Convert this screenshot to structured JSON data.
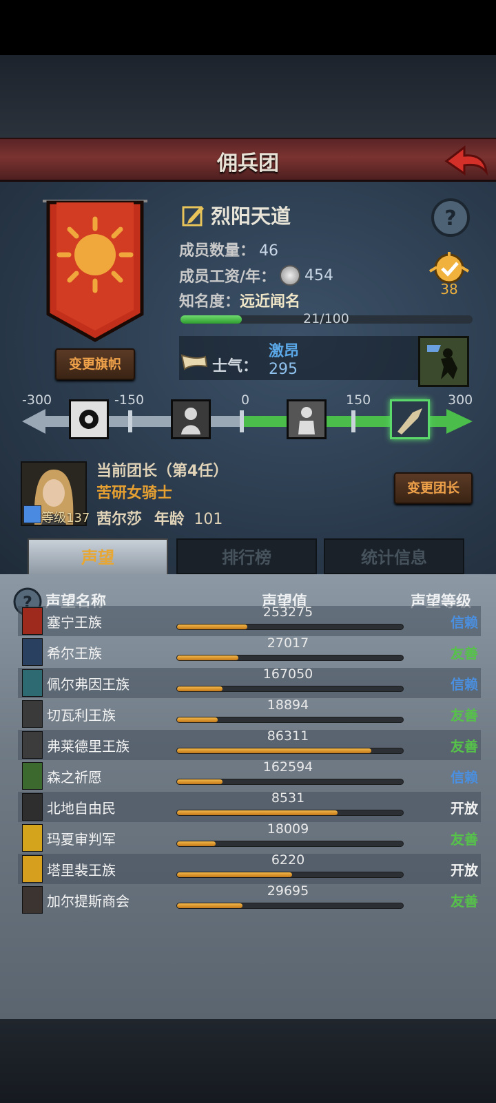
{
  "title": "佣兵团",
  "guild": {
    "name": "烈阳天道",
    "members_label": "成员数量：",
    "members_value": "46",
    "wage_label": "成员工资/年：",
    "wage_value": "454",
    "fame_label": "知名度：",
    "fame_value": "远近闻名",
    "fame_progress": "21/100",
    "fame_fraction": 0.21,
    "badge_value": "38",
    "change_flag_label": "变更旗帜"
  },
  "morale": {
    "label": "士气：",
    "state": "激昂",
    "value": "295",
    "scale_labels": [
      "-300",
      "-150",
      "0",
      "150",
      "300"
    ]
  },
  "leader": {
    "line1": "当前团长（第4任）",
    "title": "苦研女骑士",
    "name": "茜尔莎",
    "age_label": "年龄",
    "age_value": "101",
    "level_text": "等级137",
    "change_leader_label": "变更团长"
  },
  "tabs": [
    "声望",
    "排行榜",
    "统计信息"
  ],
  "reputation": {
    "headers": [
      "声望名称",
      "声望值",
      "声望等级"
    ],
    "rows": [
      {
        "name": "塞宁王族",
        "value": "253275",
        "level": "信赖",
        "fill": 0.31,
        "icon_color": "#9e2a1e",
        "level_color": "#4a8fe0"
      },
      {
        "name": "希尔王族",
        "value": "27017",
        "level": "友善",
        "fill": 0.27,
        "icon_color": "#2a4060",
        "level_color": "#56c24a"
      },
      {
        "name": "佩尔弗因王族",
        "value": "167050",
        "level": "信赖",
        "fill": 0.2,
        "icon_color": "#2e6a72",
        "level_color": "#4a8fe0"
      },
      {
        "name": "切瓦利王族",
        "value": "18894",
        "level": "友善",
        "fill": 0.18,
        "icon_color": "#3a3a3a",
        "level_color": "#56c24a"
      },
      {
        "name": "弗莱德里王族",
        "value": "86311",
        "level": "友善",
        "fill": 0.86,
        "icon_color": "#3c3c3c",
        "level_color": "#56c24a"
      },
      {
        "name": "森之祈愿",
        "value": "162594",
        "level": "信赖",
        "fill": 0.2,
        "icon_color": "#3c6a2e",
        "level_color": "#4a8fe0"
      },
      {
        "name": "北地自由民",
        "value": "8531",
        "level": "开放",
        "fill": 0.71,
        "icon_color": "#2e2e2e",
        "level_color": "#f2f2f2"
      },
      {
        "name": "玛夏审判军",
        "value": "18009",
        "level": "友善",
        "fill": 0.17,
        "icon_color": "#d4a41c",
        "level_color": "#56c24a"
      },
      {
        "name": "塔里裴王族",
        "value": "6220",
        "level": "开放",
        "fill": 0.51,
        "icon_color": "#d6a01e",
        "level_color": "#f2f2f2"
      },
      {
        "name": "加尔提斯商会",
        "value": "29695",
        "level": "友善",
        "fill": 0.29,
        "icon_color": "#3b3430",
        "level_color": "#56c24a"
      }
    ]
  }
}
